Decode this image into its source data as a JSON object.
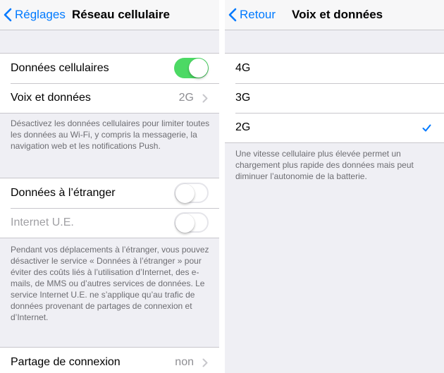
{
  "left_panel": {
    "nav": {
      "back_label": "Réglages",
      "title": "Réseau cellulaire"
    },
    "cellular_data": {
      "label": "Données cellulaires",
      "state": "on"
    },
    "voice_data": {
      "label": "Voix et données",
      "value": "2G"
    },
    "note1": "Désactivez les données cellulaires pour limiter toutes les données au Wi-Fi, y compris la messagerie, la navigation web et les notifications Push.",
    "roaming": {
      "label": "Données à l’étranger",
      "state": "off"
    },
    "eu_internet": {
      "label": "Internet U.E.",
      "state": "off"
    },
    "note2": "Pendant vos déplacements à l’étranger, vous pouvez désactiver le service « Données à l’étranger » pour éviter des coûts liés à l’utilisation d’Internet, des e-mails, de MMS ou d’autres services de données. Le service Internet U.E. ne s’applique qu’au trafic de données provenant de partages de connexion et d’Internet.",
    "hotspot": {
      "label": "Partage de connexion",
      "value": "non"
    }
  },
  "right_panel": {
    "nav": {
      "back_label": "Retour",
      "title": "Voix et données"
    },
    "options": [
      {
        "label": "4G",
        "selected": false
      },
      {
        "label": "3G",
        "selected": false
      },
      {
        "label": "2G",
        "selected": true
      }
    ],
    "note": "Une vitesse cellulaire plus élevée permet un chargement plus rapide des données mais peut diminuer l’autonomie de la batterie."
  },
  "colors": {
    "accent": "#007aff",
    "switch_on": "#4cd964",
    "background": "#efeff4",
    "separator": "#c8c7cc"
  }
}
